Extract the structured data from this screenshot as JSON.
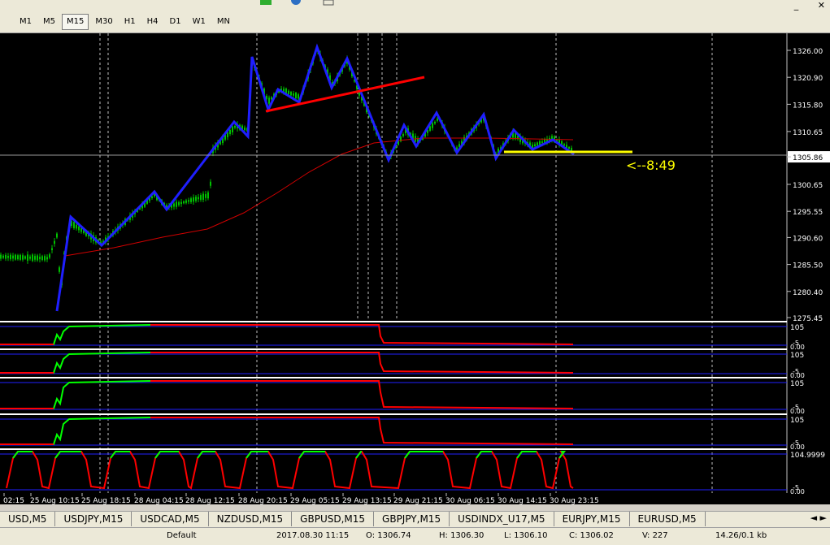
{
  "toolbar": {
    "timeframes": [
      "M1",
      "M5",
      "M15",
      "M30",
      "H1",
      "H4",
      "D1",
      "W1",
      "MN"
    ],
    "active_timeframe": "M15",
    "icons": [
      "new-order-icon",
      "globe-icon",
      "chart-window-icon"
    ]
  },
  "window_controls": {
    "minimize": "_",
    "close": "✕"
  },
  "chart": {
    "symbol_visible": false,
    "price_axis": [
      "1326.00",
      "1320.90",
      "1315.80",
      "1310.65",
      "1305.86",
      "1300.65",
      "1295.55",
      "1290.60",
      "1285.50",
      "1280.40",
      "1275.45"
    ],
    "current_price": "1305.86",
    "countdown": "<--8:49",
    "time_axis": [
      "02:15",
      "25 Aug 10:15",
      "25 Aug 18:15",
      "28 Aug 04:15",
      "28 Aug 12:15",
      "28 Aug 20:15",
      "29 Aug 05:15",
      "29 Aug 13:15",
      "29 Aug 21:15",
      "30 Aug 06:15",
      "30 Aug 14:15",
      "30 Aug 23:15"
    ],
    "colors": {
      "background": "#000000",
      "candles": "#00c000",
      "zigzag": "#1f1fff",
      "moving_average": "#d00000",
      "trendline_red": "#ff0000",
      "support_line": "#ffff00",
      "grid": "#c0c0c0",
      "osc_low": "#ff0000",
      "osc_high": "#00ff00"
    },
    "indicator_windows": [
      {
        "top": "105",
        "bottom": "-5",
        "zero": "0.00"
      },
      {
        "top": "105",
        "bottom": "-5",
        "zero": "0.00"
      },
      {
        "top": "105",
        "bottom": "-5",
        "zero": "0.00"
      },
      {
        "top": "105",
        "bottom": "-5",
        "zero": "0.00"
      },
      {
        "top": "104.9999",
        "bottom": "-5",
        "zero": "0.00"
      }
    ]
  },
  "chart_data": {
    "type": "line",
    "x": [
      "25 Aug 10:15",
      "25 Aug 18:15",
      "28 Aug 04:15",
      "28 Aug 12:15",
      "28 Aug 20:15",
      "29 Aug 05:15",
      "29 Aug 13:15",
      "29 Aug 21:15",
      "30 Aug 06:15",
      "30 Aug 14:15",
      "30 Aug 23:15"
    ],
    "series": [
      {
        "values": [
          1289.0,
          1291.0,
          1295.0,
          1304.0,
          1318.0,
          1325.0,
          1312.0,
          1309.0,
          1309.0,
          1307.0,
          1305.86
        ]
      }
    ],
    "ylim": [
      1275.45,
      1326.0
    ]
  },
  "tabs": [
    "USD,M5",
    "USDJPY,M15",
    "USDCAD,M5",
    "NZDUSD,M15",
    "GBPUSD,M15",
    "GBPJPY,M15",
    "USDINDX_U17,M5",
    "EURJPY,M15",
    "EURUSD,M5"
  ],
  "status": [
    "Default",
    "2017.08.30 11:15",
    "O: 1306.74",
    "H: 1306.30",
    "L: 1306.10",
    "C: 1306.02",
    "V: 227",
    "14.26/0.1 kb"
  ]
}
